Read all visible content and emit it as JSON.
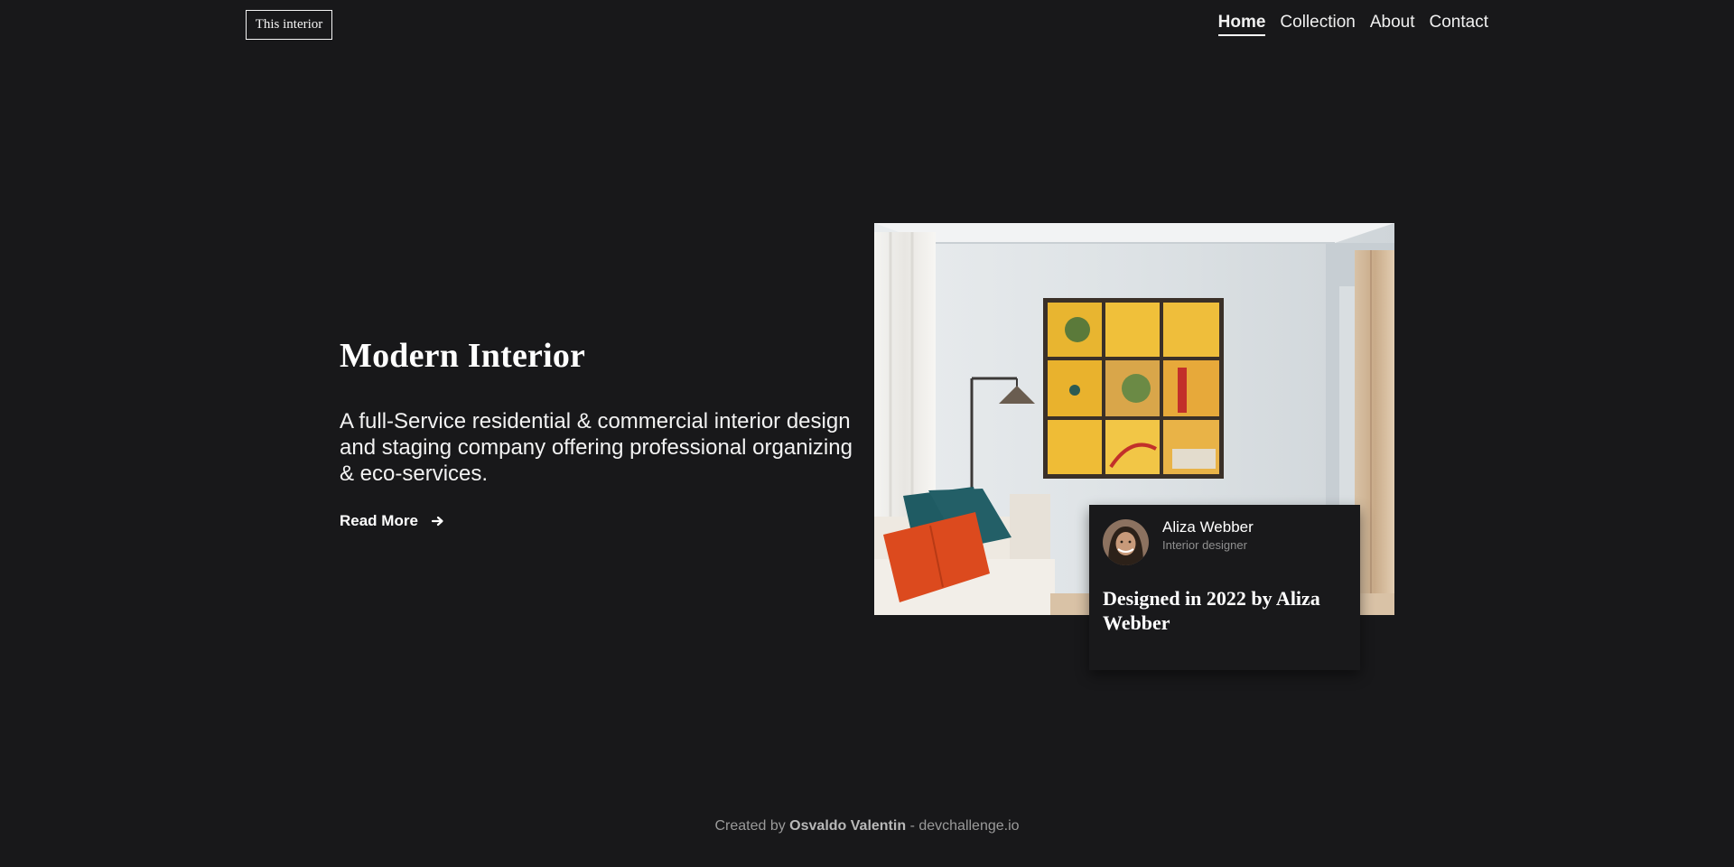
{
  "header": {
    "logo": "This interior",
    "nav": [
      {
        "label": "Home",
        "active": true
      },
      {
        "label": "Collection",
        "active": false
      },
      {
        "label": "About",
        "active": false
      },
      {
        "label": "Contact",
        "active": false
      }
    ]
  },
  "hero": {
    "title": "Modern Interior",
    "description": "A full-Service residential & commercial interior design and staging company offering professional organizing & eco-services.",
    "read_more": "Read More",
    "read_more_icon": "arrow-right-icon"
  },
  "card": {
    "name": "Aliza Webber",
    "role": "Interior designer",
    "title": "Designed in 2022 by Aliza Webber"
  },
  "footer": {
    "prefix": "Created by",
    "author": "Osvaldo Valentin",
    "separator": "-",
    "site": "devchallenge.io"
  },
  "colors": {
    "background": "#18181a",
    "text": "#f5f5f5",
    "muted": "#9a9a9a"
  }
}
